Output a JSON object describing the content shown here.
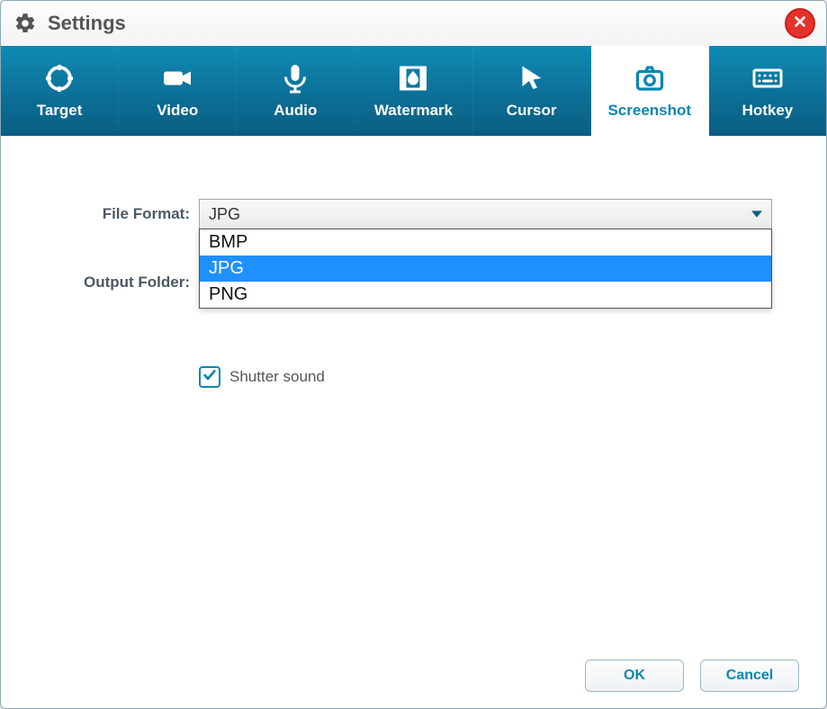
{
  "window": {
    "title": "Settings"
  },
  "tabs": [
    {
      "label": "Target",
      "icon": "target-icon",
      "active": false
    },
    {
      "label": "Video",
      "icon": "video-icon",
      "active": false
    },
    {
      "label": "Audio",
      "icon": "microphone-icon",
      "active": false
    },
    {
      "label": "Watermark",
      "icon": "watermark-icon",
      "active": false
    },
    {
      "label": "Cursor",
      "icon": "cursor-icon",
      "active": false
    },
    {
      "label": "Screenshot",
      "icon": "camera-icon",
      "active": true
    },
    {
      "label": "Hotkey",
      "icon": "keyboard-icon",
      "active": false
    }
  ],
  "form": {
    "file_format_label": "File Format:",
    "file_format_value": "JPG",
    "file_format_options": [
      "BMP",
      "JPG",
      "PNG"
    ],
    "file_format_selected_index": 1,
    "output_folder_label": "Output Folder:",
    "shutter_sound_label": "Shutter sound",
    "shutter_sound_checked": true
  },
  "footer": {
    "ok_label": "OK",
    "cancel_label": "Cancel"
  },
  "colors": {
    "accent": "#0c86b2",
    "close": "#e4322b"
  }
}
